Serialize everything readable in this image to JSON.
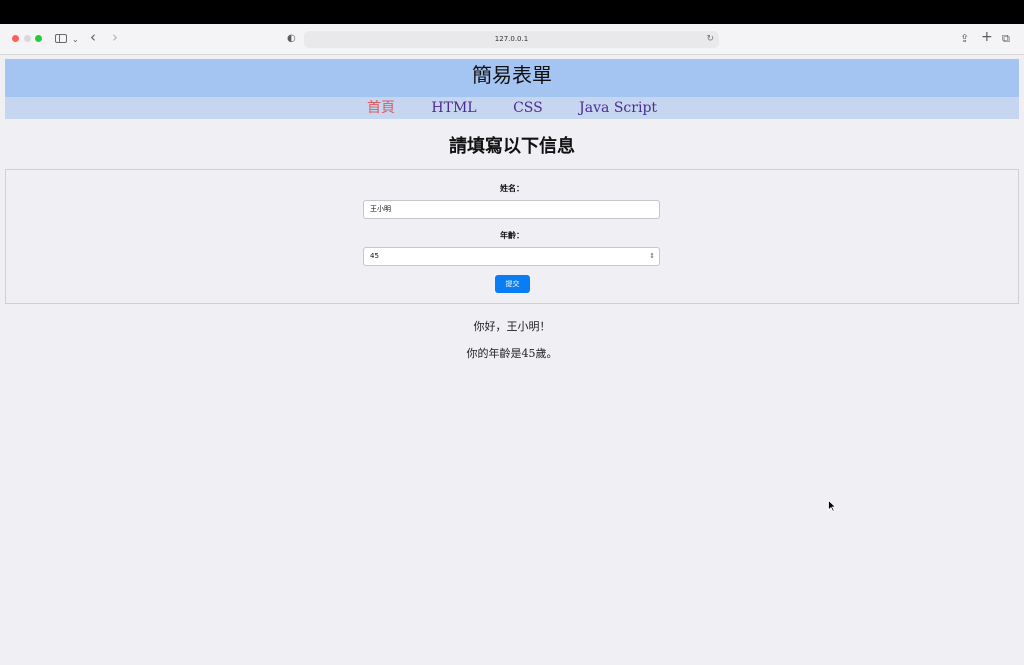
{
  "browser": {
    "url": "127.0.0.1",
    "icons": {
      "sidebar": "sidebar-icon",
      "back": "chevron-left-icon",
      "forward": "chevron-right-icon",
      "shield": "shield-icon",
      "reload": "reload-icon",
      "share": "share-icon",
      "new_tab": "plus-icon",
      "tabs": "tabs-icon"
    }
  },
  "header": {
    "title": "簡易表單",
    "bg_color": "#a4c4f2"
  },
  "nav": {
    "items": [
      {
        "label": "首頁",
        "active": true
      },
      {
        "label": "HTML",
        "active": false
      },
      {
        "label": "CSS",
        "active": false
      },
      {
        "label": "Java Script",
        "active": false
      }
    ],
    "bg_color": "#c6d6f0",
    "active_color": "#e05a5a",
    "link_color": "#4b2c8f"
  },
  "form": {
    "heading": "請填寫以下信息",
    "name_label": "姓名：",
    "name_value": "王小明",
    "age_label": "年齡：",
    "age_value": "45",
    "submit_label": "提交",
    "submit_color": "#0a7cf4"
  },
  "result": {
    "greeting": "你好，王小明！",
    "age_message": "你的年齡是45歲。"
  }
}
